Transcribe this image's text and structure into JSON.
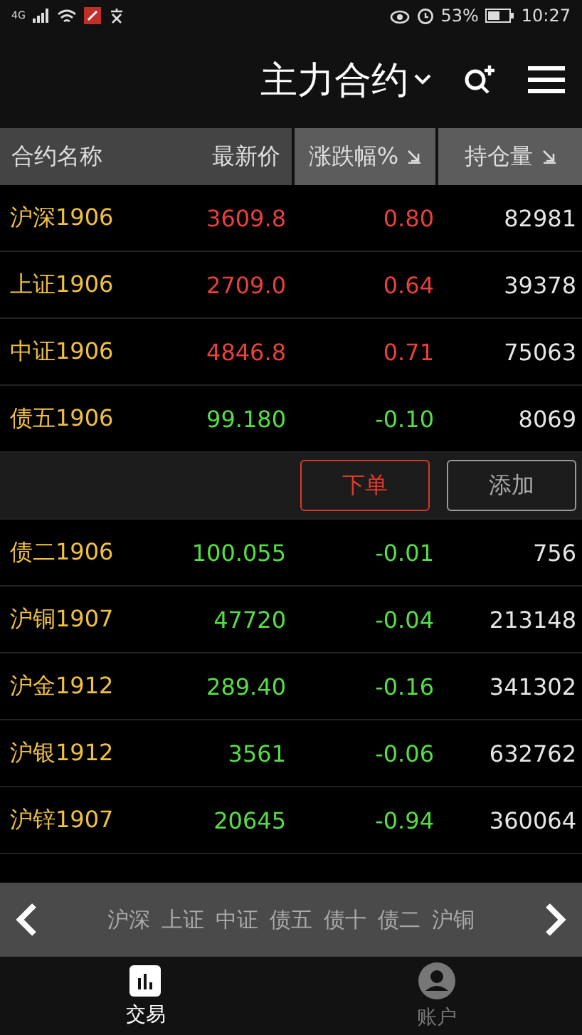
{
  "status_bar": {
    "network": "4G",
    "battery": "53%",
    "time": "10:27"
  },
  "header": {
    "title": "主力合约"
  },
  "table": {
    "columns": [
      {
        "label": "合约名称",
        "sortable": false
      },
      {
        "label": "最新价",
        "sortable": false
      },
      {
        "label": "涨跌幅%",
        "sortable": true
      },
      {
        "label": "持仓量",
        "sortable": true
      }
    ],
    "rows": [
      {
        "kind": "quote",
        "name": "沪深1906",
        "price": "3609.8",
        "change": "0.80",
        "volume": "82981",
        "rising": true
      },
      {
        "kind": "quote",
        "name": "上证1906",
        "price": "2709.0",
        "change": "0.64",
        "volume": "39378",
        "rising": true
      },
      {
        "kind": "quote",
        "name": "中证1906",
        "price": "4846.8",
        "change": "0.71",
        "volume": "75063",
        "rising": true
      },
      {
        "kind": "quote",
        "name": "债五1906",
        "price": "99.180",
        "change": "-0.10",
        "volume": "8069",
        "rising": false
      },
      {
        "kind": "actions",
        "buttons": [
          {
            "label": "下单",
            "primary": true
          },
          {
            "label": "添加",
            "primary": false
          }
        ]
      },
      {
        "kind": "quote",
        "name": "债二1906",
        "price": "100.055",
        "change": "-0.01",
        "volume": "756",
        "rising": false
      },
      {
        "kind": "quote",
        "name": "沪铜1907",
        "price": "47720",
        "change": "-0.04",
        "volume": "213148",
        "rising": false
      },
      {
        "kind": "quote",
        "name": "沪金1912",
        "price": "289.40",
        "change": "-0.16",
        "volume": "341302",
        "rising": false
      },
      {
        "kind": "quote",
        "name": "沪银1912",
        "price": "3561",
        "change": "-0.06",
        "volume": "632762",
        "rising": false
      },
      {
        "kind": "quote",
        "name": "沪锌1907",
        "price": "20645",
        "change": "-0.94",
        "volume": "360064",
        "rising": false
      }
    ]
  },
  "category_bar": {
    "items": [
      "沪深",
      "上证",
      "中证",
      "债五",
      "债十",
      "债二",
      "沪铜"
    ]
  },
  "bottom_nav": [
    {
      "label": "交易",
      "selected": true,
      "kind": "chart"
    },
    {
      "label": "账户",
      "selected": false,
      "kind": "user"
    }
  ]
}
